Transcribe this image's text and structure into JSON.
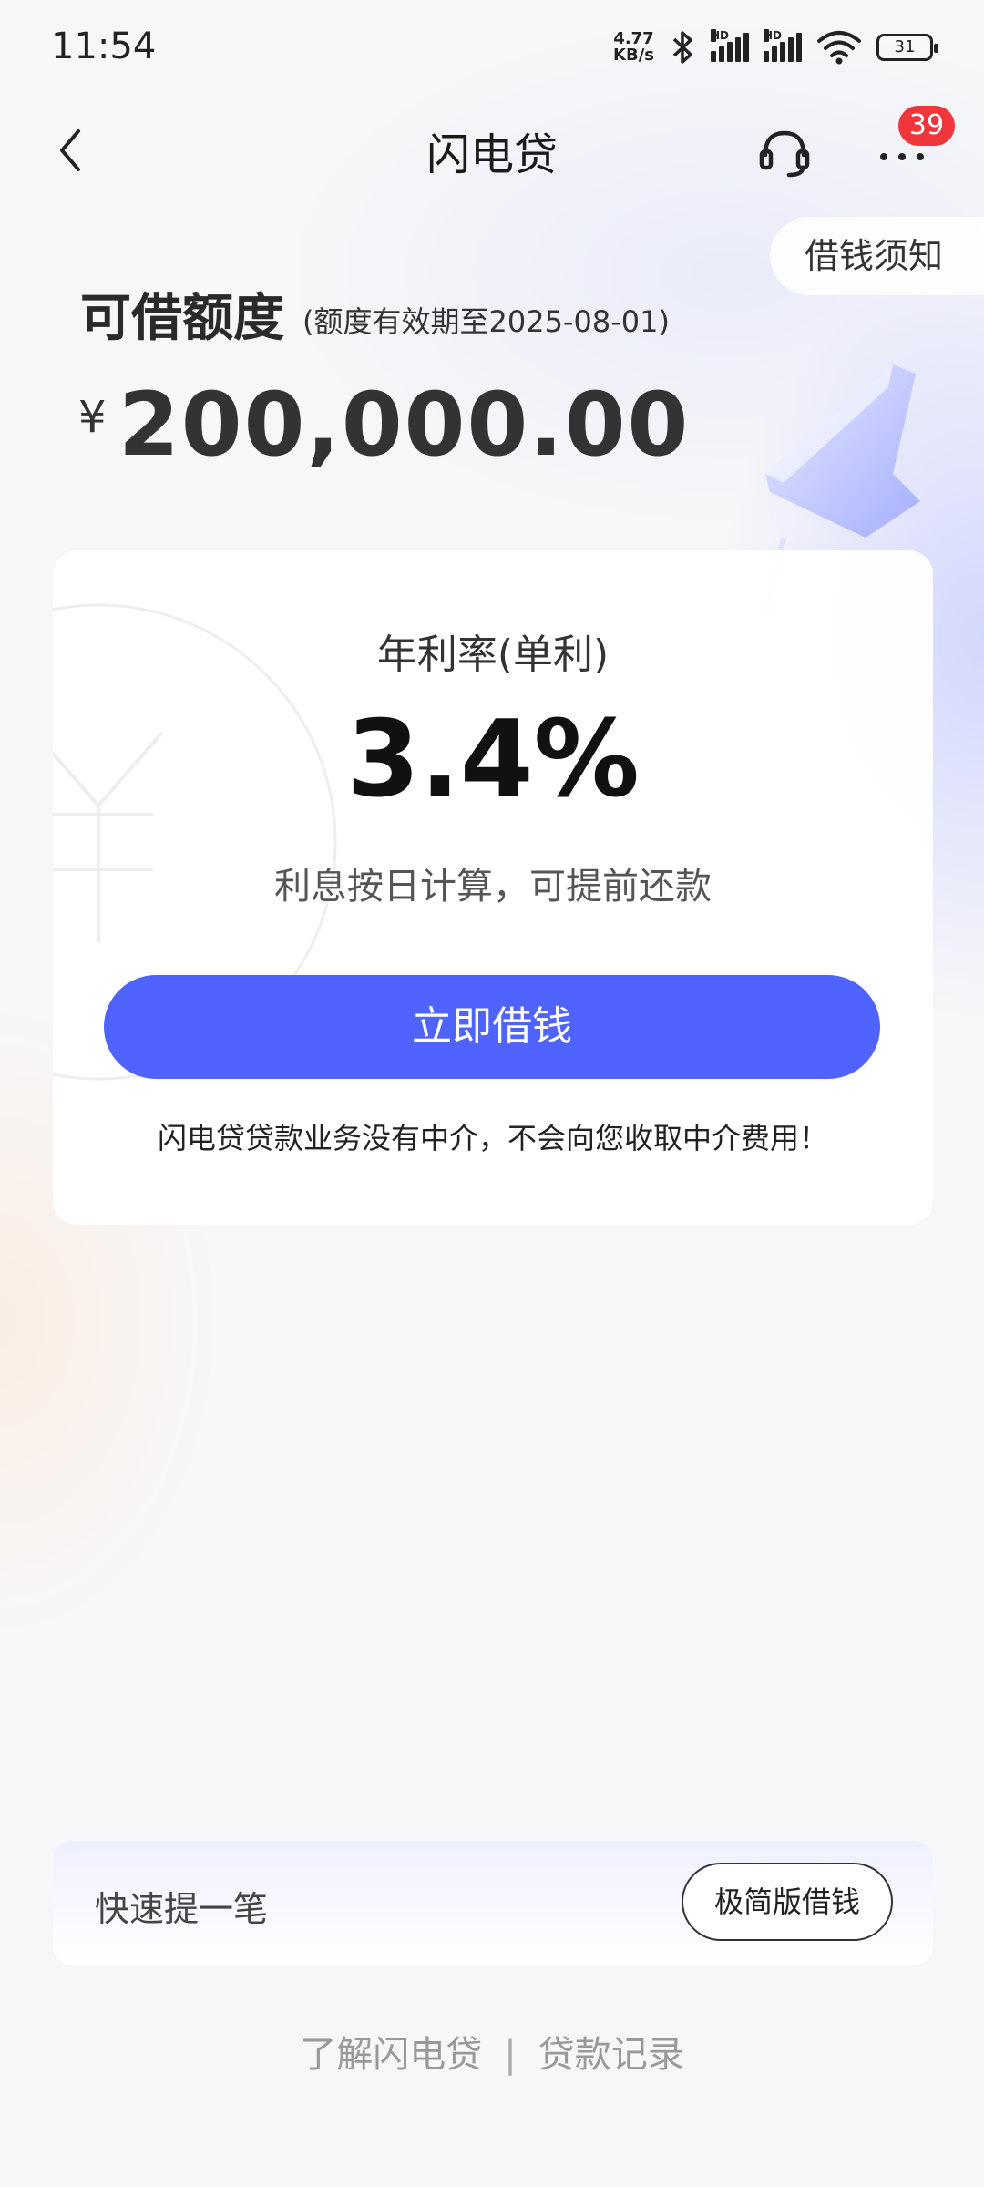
{
  "status_bar": {
    "time": "11:54",
    "net_speed_value": "4.77",
    "net_speed_unit": "KB/s",
    "signal_label": "HD",
    "battery": "31"
  },
  "nav": {
    "title": "闪电贷",
    "badge_count": "39",
    "icons": [
      "chevron-left-icon",
      "headset-icon",
      "more-icon"
    ]
  },
  "notice": {
    "label": "借钱须知"
  },
  "credit": {
    "label": "可借额度",
    "validity": "(额度有效期至2025-08-01)",
    "currency": "¥",
    "amount": "200,000.00"
  },
  "rate_card": {
    "label": "年利率(单利)",
    "value": "3.4%",
    "description": "利息按日计算，可提前还款",
    "button_label": "立即借钱",
    "disclaimer": "闪电贷贷款业务没有中介，不会向您收取中介费用！"
  },
  "quick_bar": {
    "label": "快速提一笔",
    "button_label": "极简版借钱"
  },
  "footer": {
    "link_about": "了解闪电贷",
    "separator": "|",
    "link_records": "贷款记录"
  },
  "colors": {
    "accent": "#4e63ff",
    "badge": "#f0363b",
    "background": "#f7f7f9"
  }
}
